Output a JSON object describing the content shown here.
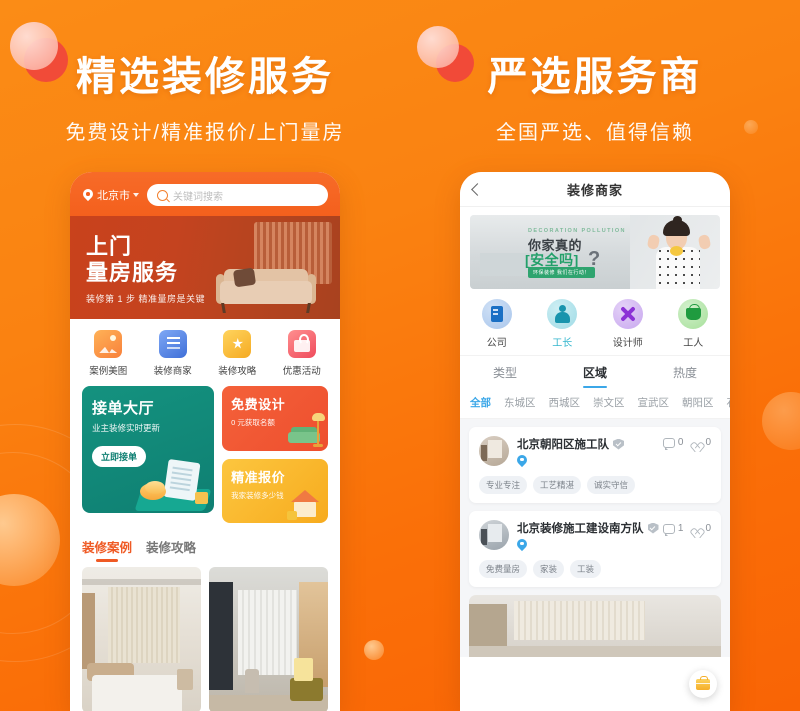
{
  "headings": {
    "left": {
      "title": "精选装修服务",
      "subtitle": "免费设计/精准报价/上门量房"
    },
    "right": {
      "title": "严选服务商",
      "subtitle": "全国严选、值得信赖"
    }
  },
  "colors": {
    "background_orange": "#fa8211",
    "accent_orange": "#ef5a24",
    "accent_blue": "#3ba7e8",
    "teal_card": "#0f7f72",
    "yellow_card": "#f7ab1e"
  },
  "left_phone": {
    "topbar": {
      "city": "北京市",
      "city_caret_icon": "chevron-down-icon",
      "location_icon": "location-pin-icon",
      "search_icon": "search-icon",
      "search_placeholder": "关键词搜索"
    },
    "banner": {
      "title_line1": "上门",
      "title_line2": "量房服务",
      "subtitle": "装修第 1 步 精准量房是关键"
    },
    "quick_icons": [
      {
        "label": "案例美图",
        "icon": "photo-gallery-icon"
      },
      {
        "label": "装修商家",
        "icon": "document-merchant-icon"
      },
      {
        "label": "装修攻略",
        "icon": "star-ticket-icon"
      },
      {
        "label": "优惠活动",
        "icon": "gift-icon"
      }
    ],
    "cards": {
      "order_hall": {
        "title": "接单大厅",
        "subtitle": "业主装修实时更新",
        "button": "立即接单"
      },
      "free_design": {
        "title": "免费设计",
        "subtitle": "0 元获取名额"
      },
      "accurate_quote": {
        "title": "精准报价",
        "subtitle": "我家装修多少钱"
      }
    },
    "tabs": [
      {
        "label": "装修案例",
        "active": true
      },
      {
        "label": "装修攻略",
        "active": false
      }
    ]
  },
  "right_phone": {
    "header": {
      "title": "装修商家",
      "back_icon": "chevron-left-icon"
    },
    "banner": {
      "eng": "DECORATION  POLLUTION",
      "line1": "你家真的",
      "line2": "[安全吗]",
      "question_mark": "?",
      "pill": "环保装修 我们在行动！"
    },
    "categories": [
      {
        "label": "公司",
        "icon": "company-icon",
        "active": false
      },
      {
        "label": "工长",
        "icon": "foreman-icon",
        "active": true
      },
      {
        "label": "设计师",
        "icon": "designer-tools-icon",
        "active": false
      },
      {
        "label": "工人",
        "icon": "paint-bucket-icon",
        "active": false
      }
    ],
    "filter_tabs": [
      {
        "label": "类型",
        "active": false
      },
      {
        "label": "区域",
        "active": true
      },
      {
        "label": "热度",
        "active": false
      }
    ],
    "districts": [
      {
        "label": "全部",
        "active": true
      },
      {
        "label": "东城区",
        "active": false
      },
      {
        "label": "西城区",
        "active": false
      },
      {
        "label": "崇文区",
        "active": false
      },
      {
        "label": "宣武区",
        "active": false
      },
      {
        "label": "朝阳区",
        "active": false
      },
      {
        "label": "石",
        "active": false
      }
    ],
    "merchants": [
      {
        "name": "北京朝阳区施工队",
        "verified_icon": "verified-badge-icon",
        "location_icon": "location-pin-icon",
        "comment_icon": "comment-icon",
        "comment_count": "0",
        "like_icon": "heart-icon",
        "like_count": "0",
        "tags": [
          "专业专注",
          "工艺精湛",
          "诚实守信"
        ]
      },
      {
        "name": "北京装修施工建设南方队",
        "verified_icon": "verified-badge-icon",
        "location_icon": "location-pin-icon",
        "comment_icon": "comment-icon",
        "comment_count": "1",
        "like_icon": "heart-icon",
        "like_count": "0",
        "tags": [
          "免费量房",
          "家装",
          "工装"
        ]
      }
    ],
    "fab": {
      "icon": "toolbox-icon"
    }
  }
}
